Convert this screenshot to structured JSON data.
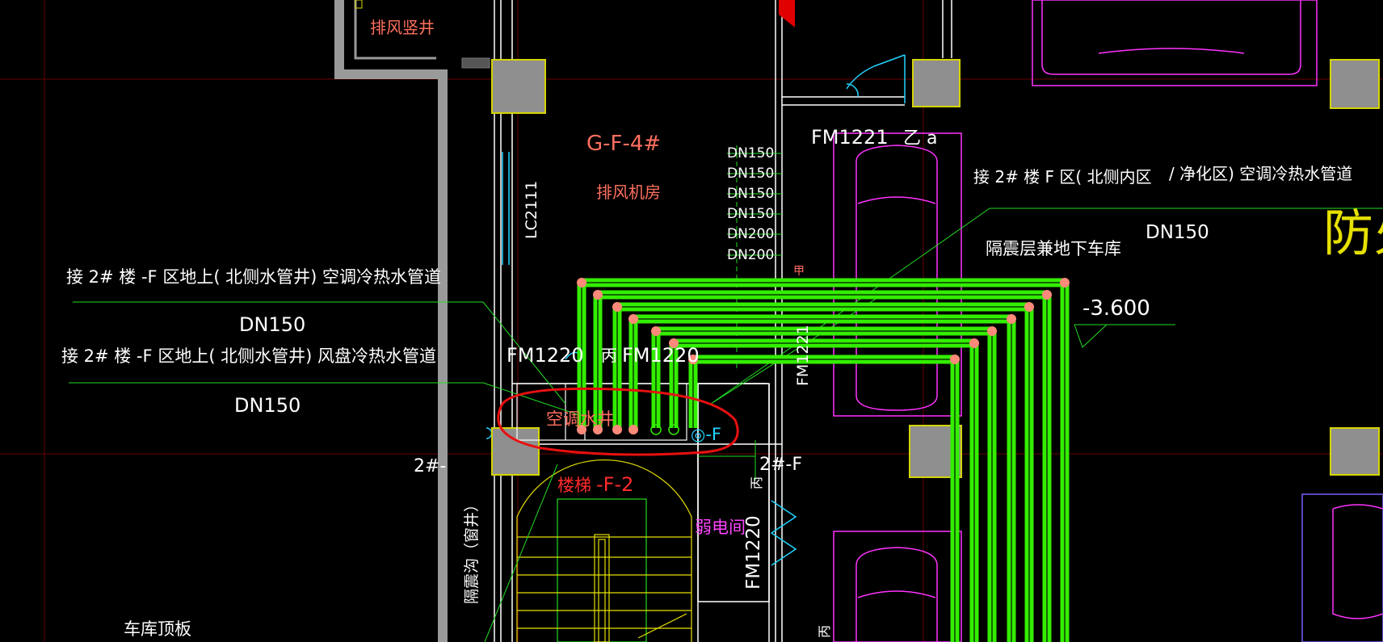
{
  "colors": {
    "background": "#000000",
    "pipe_green": "#33ee00",
    "wall_gray": "#9a9a9a",
    "column_yellow": "#d4d400",
    "room_label_red": "#ff7060",
    "parking_magenta": "#ff33ff",
    "dimension_white": "#ffffff",
    "highlight_ring_red": "#e81010"
  },
  "labels": {
    "exhaust_shaft": "排风竖井",
    "room_code": "G-F-4#",
    "exhaust_fan_room": "排风机房",
    "window_lc": "LC2111",
    "door_fm1221": "FM1221",
    "door_fm1221_tag": "乙 a",
    "door_fm1220_left": "FM1220",
    "door_fm1220_right_prefix": "丙",
    "door_fm1220_right": "FM1220",
    "door_fm1220_lower": "FM1220",
    "door_fm1220_side": "FM1220",
    "ac_shaft": "空调水井",
    "shaft_tag": "◎-F",
    "stair": "楼梯",
    "stair_code": "-F-2",
    "weak_elec_room": "弱电间",
    "axis_left": "2#-",
    "axis_right": "2#-F",
    "isolation_garage": "隔震层兼地下车库",
    "elevation": "-3.600",
    "fire_partial": "防火",
    "garage_roof": "车库顶板",
    "isolation_trench": "隔震沟（窗井）",
    "vertical_tag": "FM1221",
    "small_mark_1": "甲",
    "small_mark_2": "丙",
    "small_mark_3": "丙"
  },
  "pipe_sizes": [
    "DN150",
    "DN150",
    "DN150",
    "DN150",
    "DN200",
    "DN200"
  ],
  "annotations": {
    "top_right_line": "接 2# 楼 F 区( 北侧内区",
    "top_right_line_b": "/ 净化区) 空调冷热水管道",
    "top_right_size": "DN150",
    "left_line_1": "接 2# 楼 -F 区地上( 北侧水管井) 空调冷热水管道",
    "left_size_1": "DN150",
    "left_line_2": "接 2# 楼 -F 区地上( 北侧水管井) 风盘冷热水管道",
    "left_size_2": "DN150"
  }
}
